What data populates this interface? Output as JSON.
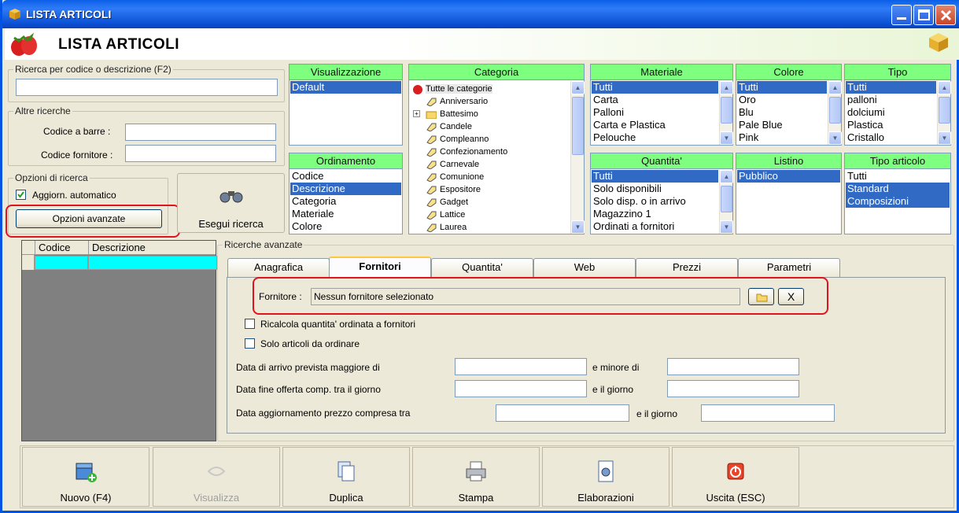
{
  "window": {
    "title": "LISTA ARTICOLI"
  },
  "header": {
    "title": "LISTA ARTICOLI"
  },
  "search": {
    "legend": "Ricerca per codice o descrizione (F2)",
    "value": ""
  },
  "other": {
    "legend": "Altre ricerche",
    "barcode_label": "Codice a barre :",
    "supplier_code_label": "Codice fornitore :"
  },
  "options": {
    "legend": "Opzioni di ricerca",
    "auto_update": "Aggiorn. automatico",
    "advanced_button": "Opzioni avanzate"
  },
  "run_search": {
    "label": "Esegui ricerca"
  },
  "panels": {
    "visualizzazione": {
      "title": "Visualizzazione",
      "items": [
        "Default"
      ]
    },
    "ordinamento": {
      "title": "Ordinamento",
      "items": [
        "Codice",
        "Descrizione",
        "Categoria",
        "Materiale",
        "Colore"
      ]
    },
    "categoria": {
      "title": "Categoria",
      "items": [
        "Tutte le categorie",
        "Anniversario",
        "Battesimo",
        "Candele",
        "Compleanno",
        "Confezionamento",
        "Carnevale",
        "Comunione",
        "Espositore",
        "Gadget",
        "Lattice",
        "Laurea"
      ]
    },
    "materiale": {
      "title": "Materiale",
      "items": [
        "Tutti",
        "Carta",
        "Palloni",
        "Carta e Plastica",
        "Pelouche"
      ]
    },
    "colore": {
      "title": "Colore",
      "items": [
        "Tutti",
        "Oro",
        "Blu",
        "Pale Blue",
        "Pink"
      ]
    },
    "tipo": {
      "title": "Tipo",
      "items": [
        "Tutti",
        "palloni",
        "dolciumi",
        "Plastica",
        "Cristallo"
      ]
    },
    "quantita": {
      "title": "Quantita'",
      "items": [
        "Tutti",
        "Solo disponibili",
        "Solo disp. o in arrivo",
        "Magazzino 1",
        "Ordinati a fornitori"
      ]
    },
    "listino": {
      "title": "Listino",
      "items": [
        "Pubblico"
      ]
    },
    "tipo_articolo": {
      "title": "Tipo articolo",
      "items": [
        "Tutti",
        "Standard",
        "Composizioni"
      ]
    }
  },
  "grid": {
    "col1": "Codice",
    "col2": "Descrizione"
  },
  "advanced": {
    "legend": "Ricerche avanzate",
    "tabs": [
      "Anagrafica",
      "Fornitori",
      "Quantita'",
      "Web",
      "Prezzi",
      "Parametri"
    ],
    "supplier_label": "Fornitore :",
    "supplier_value": "Nessun fornitore selezionato",
    "clear": "X",
    "recalc": "Ricalcola quantita' ordinata a fornitori",
    "only_to_order": "Solo articoli da ordinare",
    "arrival_label": "Data di arrivo prevista maggiore di",
    "arrival_and": "e minore di",
    "offer_label": "Data fine offerta comp. tra il giorno",
    "offer_and": "e il giorno",
    "price_label": "Data aggiornamento prezzo compresa tra",
    "price_and": "e il giorno"
  },
  "buttons": {
    "new": "Nuovo (F4)",
    "view": "Visualizza",
    "duplicate": "Duplica",
    "print": "Stampa",
    "process": "Elaborazioni",
    "exit": "Uscita (ESC)"
  }
}
